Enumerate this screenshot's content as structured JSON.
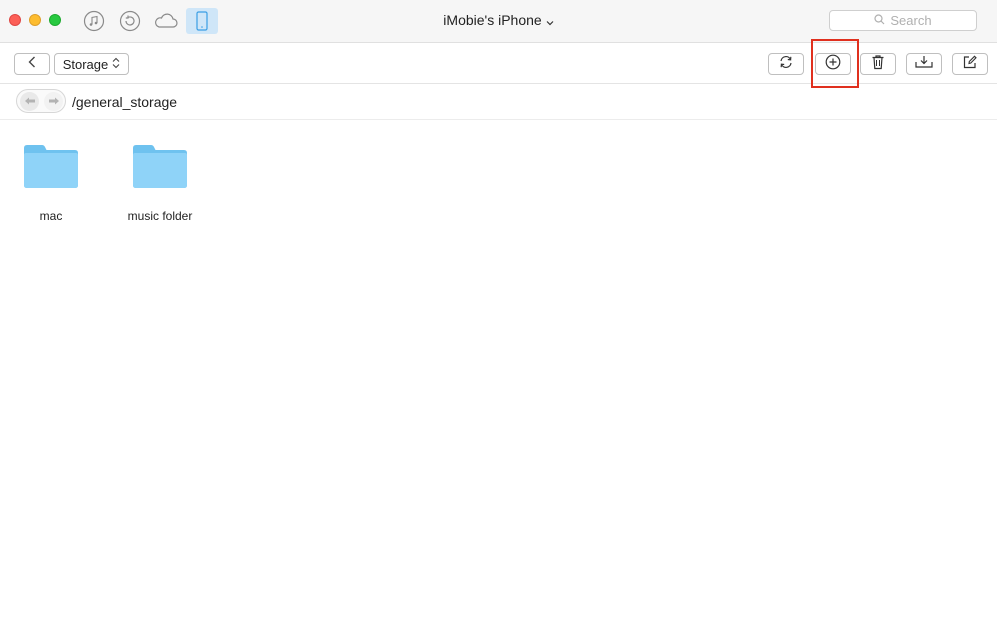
{
  "window": {
    "title": "iMobie's iPhone",
    "search_placeholder": "Search"
  },
  "toolbar": {
    "category_select": "Storage"
  },
  "path": {
    "current": "/general_storage"
  },
  "files": [
    {
      "name": "mac",
      "icon": "folder-icon"
    },
    {
      "name": "music folder",
      "icon": "folder-icon"
    }
  ],
  "colors": {
    "folder": "#7ccdf6",
    "highlight": "#e0301e",
    "active_tab_bg": "#cfe6f8"
  }
}
